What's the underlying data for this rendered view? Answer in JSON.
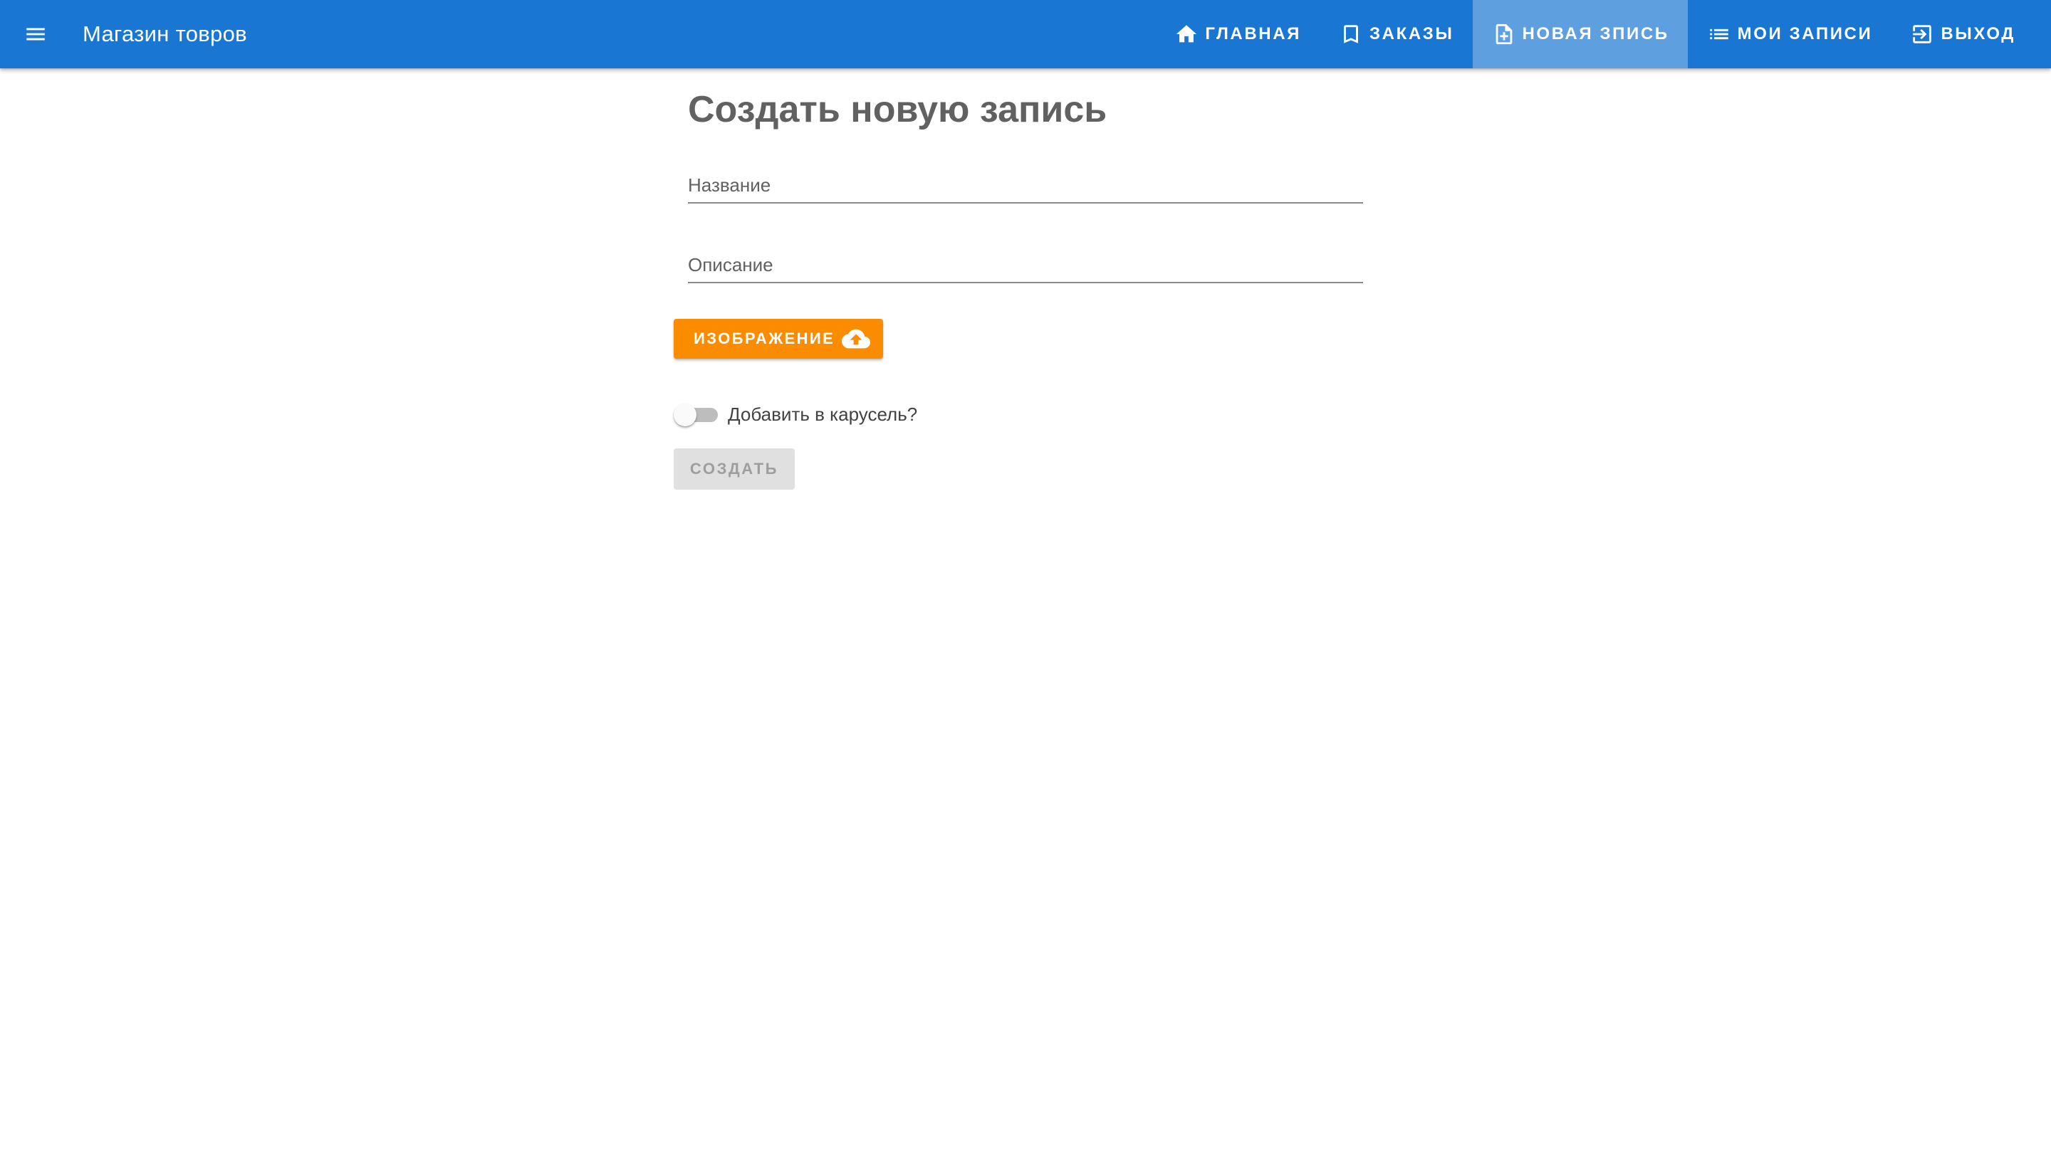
{
  "app": {
    "title": "Магазин товров",
    "menu_icon": "menu-icon"
  },
  "nav": {
    "items": [
      {
        "label": "Главная",
        "icon": "home-icon",
        "active": false
      },
      {
        "label": "Заказы",
        "icon": "bookmark-icon",
        "active": false
      },
      {
        "label": "Новая зпись",
        "icon": "note-add-icon",
        "active": true
      },
      {
        "label": "Мои записи",
        "icon": "list-icon",
        "active": false
      },
      {
        "label": "Выход",
        "icon": "exit-icon",
        "active": false
      }
    ]
  },
  "form": {
    "title": "Создать новую запись",
    "name_label": "Название",
    "name_value": "",
    "description_label": "Описание",
    "description_value": "",
    "image_button_label": "Изображение",
    "image_button_icon": "cloud-upload-icon",
    "carousel_switch_label": "Добавить в карусель?",
    "carousel_switch_on": false,
    "create_button_label": "Создать",
    "create_button_disabled": true
  },
  "colors": {
    "toolbar": "#1976d2",
    "image_button": "#fb8c00",
    "disabled_button": "#e0e0e0",
    "text": "#616161"
  }
}
